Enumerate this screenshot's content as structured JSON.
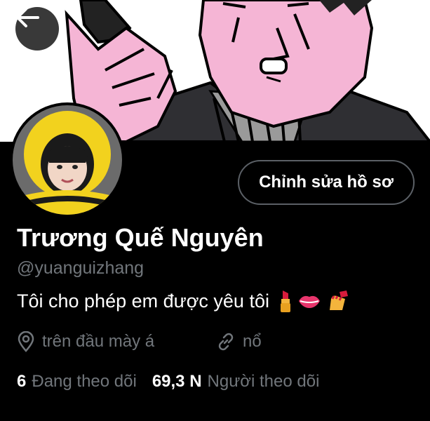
{
  "header": {
    "back_icon": "arrow-left-icon"
  },
  "profile": {
    "edit_label": "Chỉnh sửa hồ sơ",
    "name": "Trương Quế Nguyên",
    "handle": "@yuanguizhang",
    "bio": "Tôi cho phép em được yêu tôi",
    "bio_emojis": [
      "lipstick-icon",
      "lips-icon",
      "nail-polish-icon"
    ],
    "location": "trên đầu mày á",
    "location_icon": "location-pin-icon",
    "link": "nổ",
    "link_icon": "link-icon"
  },
  "stats": {
    "following_count": "6",
    "following_label": "Đang theo dõi",
    "followers_count": "69,3 N",
    "followers_label": "Người theo dõi"
  },
  "colors": {
    "background": "#000000",
    "secondary_text": "#71767b",
    "banner_skin": "#f5b5d5",
    "button_border": "#5b6066"
  }
}
